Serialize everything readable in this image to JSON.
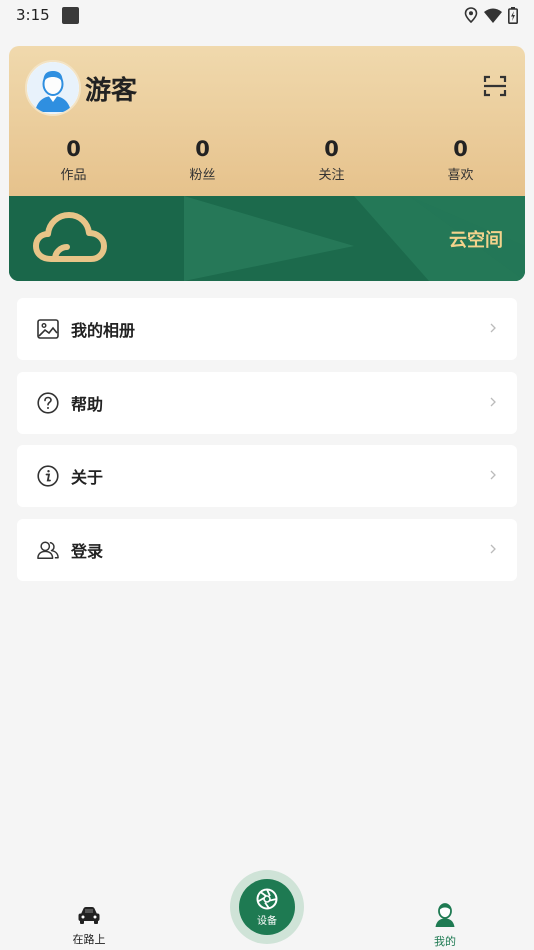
{
  "status_bar": {
    "time": "3:15"
  },
  "profile": {
    "username": "游客",
    "stats": [
      {
        "value": "0",
        "label": "作品"
      },
      {
        "value": "0",
        "label": "粉丝"
      },
      {
        "value": "0",
        "label": "关注"
      },
      {
        "value": "0",
        "label": "喜欢"
      }
    ]
  },
  "cloud_banner": {
    "label": "云空间"
  },
  "menu": [
    {
      "label": "我的相册",
      "icon": "image-icon"
    },
    {
      "label": "帮助",
      "icon": "help-circle-icon"
    },
    {
      "label": "关于",
      "icon": "info-circle-icon"
    },
    {
      "label": "登录",
      "icon": "users-icon"
    }
  ],
  "bottom_nav": {
    "left": {
      "label": "在路上",
      "icon": "car-icon"
    },
    "center": {
      "label": "设备",
      "icon": "aperture-icon"
    },
    "right": {
      "label": "我的",
      "icon": "user-icon"
    }
  },
  "colors": {
    "brand_green": "#1e7a52",
    "gold_card": "#e6c28c",
    "cloud_gold": "#f3d38c"
  }
}
